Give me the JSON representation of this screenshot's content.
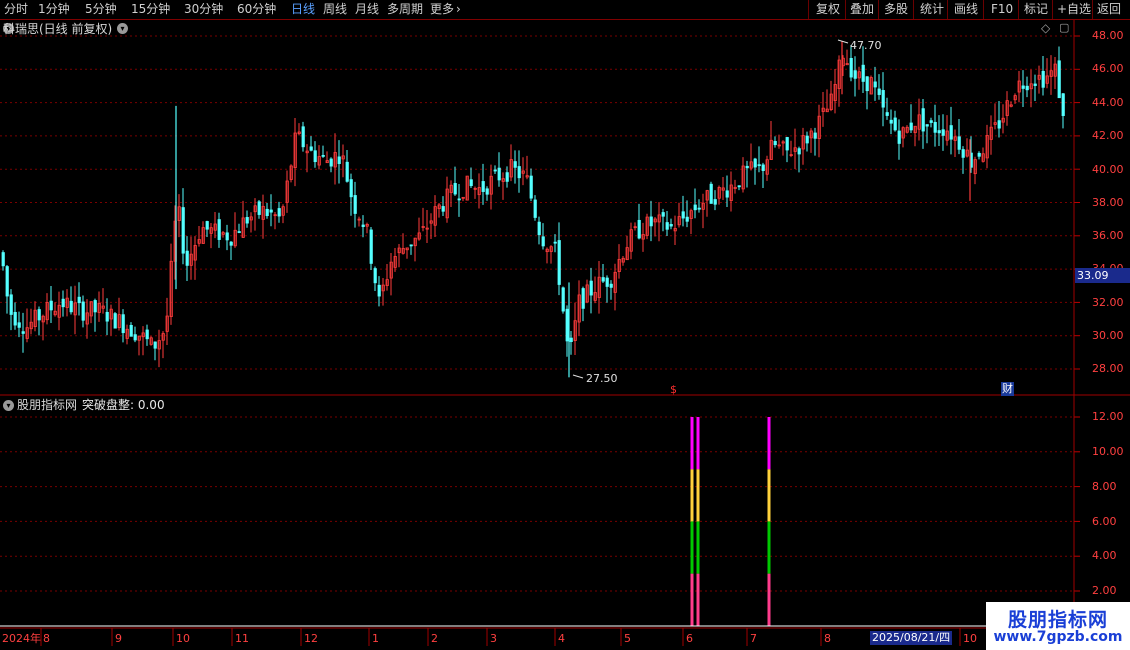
{
  "toolbar": {
    "periods": [
      "分时",
      "1分钟",
      "5分钟",
      "15分钟",
      "30分钟",
      "60分钟",
      "日线",
      "周线",
      "月线",
      "多周期",
      "更多"
    ],
    "active_period": "日线",
    "tools": [
      "复权",
      "叠加",
      "多股",
      "统计",
      "画线",
      "F10",
      "标记",
      "+自选",
      "返回"
    ]
  },
  "main_chart": {
    "title": "科瑞思(日线 前复权)",
    "high_label": "47.70",
    "low_label": "27.50",
    "current_price": "33.09",
    "y_ticks": [
      "48.00",
      "46.00",
      "44.00",
      "42.00",
      "40.00",
      "38.00",
      "36.00",
      "34.00",
      "32.00",
      "30.00",
      "28.00"
    ],
    "marker_s": "$",
    "marker_cai": "财"
  },
  "indicator": {
    "name": "股朋指标网",
    "series_label": "突破盘整: 0.00",
    "y_ticks": [
      "12.00",
      "10.00",
      "8.00",
      "6.00",
      "4.00",
      "2.00"
    ]
  },
  "x_axis": {
    "labels": [
      "2024年",
      "8",
      "9",
      "10",
      "11",
      "12",
      "1",
      "2",
      "3",
      "4",
      "5",
      "6",
      "7",
      "8",
      "2025/08/21/四",
      "10"
    ]
  },
  "watermark": {
    "title": "股朋指标网",
    "url": "www.7gpzb.com"
  },
  "colors": {
    "up": "#ff3b3b",
    "down": "#54ffff",
    "grid": "#7a0000",
    "axis_text": "#ff4040",
    "magenta": "#ff00ff",
    "yellow": "#ffd23c",
    "green": "#00c800",
    "pink": "#ff3c8c"
  },
  "chart_data": {
    "type": "bar",
    "series": [
      {
        "name": "突破盘整",
        "values": [
          {
            "date_position": "6月 (1st)",
            "segments": [
              3,
              6,
              9,
              12
            ]
          },
          {
            "date_position": "6月 (2nd)",
            "segments": [
              3,
              6,
              9,
              12
            ]
          },
          {
            "date_position": "7月",
            "segments": [
              3,
              6,
              9,
              12
            ]
          }
        ]
      }
    ],
    "ylim": [
      0,
      12.5
    ]
  }
}
